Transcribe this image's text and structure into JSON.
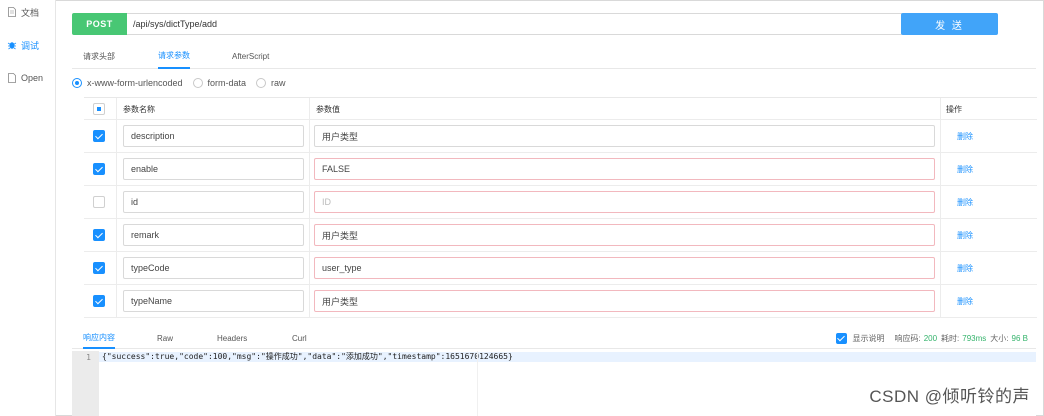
{
  "sidebar": {
    "items": [
      {
        "label": "文档",
        "icon": "document-icon"
      },
      {
        "label": "调试",
        "icon": "debug-icon",
        "active": true
      },
      {
        "label": "Open",
        "icon": "file-icon"
      }
    ]
  },
  "request": {
    "method": "POST",
    "url": "/api/sys/dictType/add",
    "send_label": "发 送"
  },
  "tabs": [
    "请求头部",
    "请求参数",
    "AfterScript"
  ],
  "active_tab": "请求参数",
  "body_types": [
    {
      "label": "x-www-form-urlencoded",
      "selected": true
    },
    {
      "label": "form-data",
      "selected": false
    },
    {
      "label": "raw",
      "selected": false
    }
  ],
  "params_table": {
    "headers": {
      "name": "参数名称",
      "value": "参数值",
      "action": "操作"
    },
    "rows": [
      {
        "checked": true,
        "name": "description",
        "value": "用户类型",
        "placeholder": "",
        "warn": false
      },
      {
        "checked": true,
        "name": "enable",
        "value": "FALSE",
        "placeholder": "",
        "warn": true
      },
      {
        "checked": false,
        "name": "id",
        "value": "",
        "placeholder": "ID",
        "warn": true
      },
      {
        "checked": true,
        "name": "remark",
        "value": "用户类型",
        "placeholder": "",
        "warn": true
      },
      {
        "checked": true,
        "name": "typeCode",
        "value": "user_type",
        "placeholder": "",
        "warn": true
      },
      {
        "checked": true,
        "name": "typeName",
        "value": "用户类型",
        "placeholder": "",
        "warn": true
      }
    ],
    "delete_label": "删除"
  },
  "response": {
    "tabs": [
      "响应内容",
      "Raw",
      "Headers",
      "Curl"
    ],
    "active_tab": "响应内容",
    "show_desc_label": "显示说明",
    "status_label": "响应码:",
    "status_value": "200",
    "time_label": "耗时:",
    "time_value": "793ms",
    "size_label": "大小:",
    "size_value": "96 B",
    "line_number": "1",
    "body": "{\"success\":true,\"code\":100,\"msg\":\"操作成功\",\"data\":\"添加成功\",\"timestamp\":1651670124665}"
  },
  "watermark": "CSDN @倾听铃的声",
  "colors": {
    "method_bg": "#48c774",
    "send_bg": "#41a4f9",
    "accent": "#1890ff",
    "status_green": "#33b36b"
  }
}
